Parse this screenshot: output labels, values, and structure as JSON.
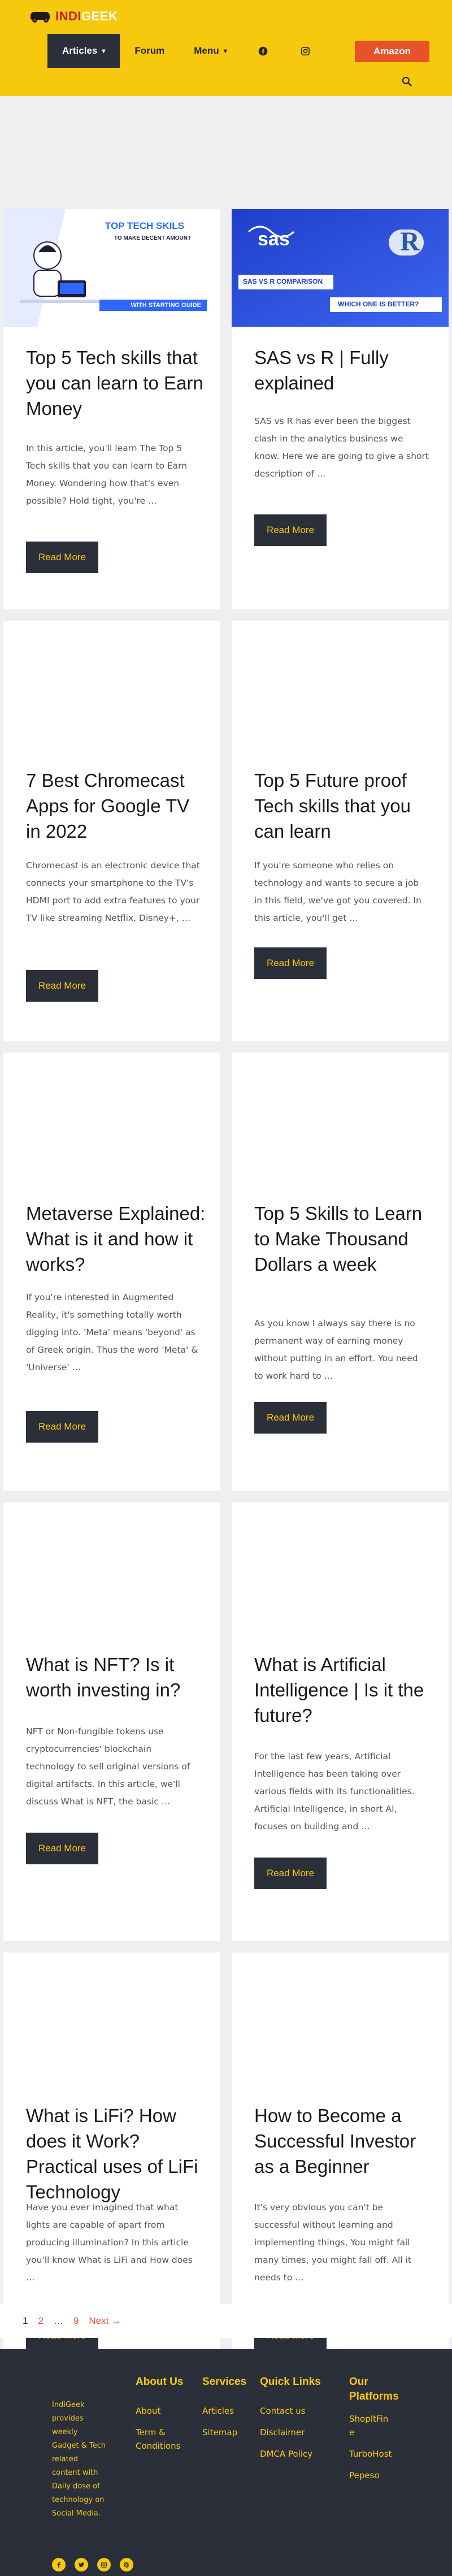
{
  "site": {
    "logo_part1": "INDI",
    "logo_part2": "GEEK",
    "logo_alt": "IndiGeek"
  },
  "nav": {
    "items": [
      {
        "label": "Articles",
        "has_dropdown": true,
        "active": true
      },
      {
        "label": "Forum",
        "has_dropdown": false
      },
      {
        "label": "Menu",
        "has_dropdown": true
      }
    ],
    "social": [
      "facebook-icon",
      "instagram-icon"
    ],
    "cta_label": "Amazon",
    "search_icon": "search-icon",
    "colors": {
      "header_bg": "#f6c90e",
      "active_bg": "#2b2f3a",
      "cta_bg": "#e8522b"
    }
  },
  "posts": [
    {
      "image": {
        "title": "TOP TECH SKILS",
        "subtitle": "TO MAKE DECENT AMOUNT",
        "badge": "WITH STARTING GUIDE"
      },
      "title": "Top 5 Tech skills that you can learn to Earn Money",
      "excerpt": "In this article, you'll learn The Top 5 Tech skills that you can learn to Earn Money. Wondering how that's even possible? Hold tight, you're …",
      "read_more": "Read More"
    },
    {
      "image": {
        "logo_left": "sas",
        "logo_right": "R",
        "tag1": "SAS VS R COMPARISON",
        "tag2": "WHICH ONE IS BETTER?"
      },
      "title": "SAS vs R | Fully explained",
      "excerpt": "SAS vs R has ever been the biggest clash in the analytics business we know. Here we are going to give a short description of …",
      "read_more": "Read More"
    },
    {
      "title": "7 Best Chromecast Apps for Google TV in 2022",
      "excerpt": "Chromecast is an electronic device that connects your smartphone to the TV's HDMI port to add extra features to your TV like streaming Netflix, Disney+, …",
      "read_more": "Read More"
    },
    {
      "title": "Top 5 Future proof Tech skills that you can learn",
      "excerpt": "If you're someone who relies on technology and wants to secure a job in this field, we've got you covered. In this article, you'll get …",
      "read_more": "Read More"
    },
    {
      "title": "Metaverse Explained: What is it and how it works?",
      "excerpt": "If you're interested in Augmented Reality, it's something totally worth digging into. 'Meta' means 'beyond' as of Greek origin. Thus the word 'Meta' & 'Universe' …",
      "read_more": "Read More"
    },
    {
      "title": "Top 5 Skills to Learn to Make Thousand Dollars a week",
      "excerpt": "As you know I always say there is no permanent way of earning money without putting in an effort. You need to work hard to …",
      "read_more": "Read More"
    },
    {
      "title": "What is NFT? Is it worth investing in?",
      "excerpt": "NFT or Non-fungible tokens use cryptocurrencies' blockchain technology to sell original versions of digital artifacts. In this article, we'll discuss What is NFT, the basic …",
      "read_more": "Read More"
    },
    {
      "title": "What is Artificial Intelligence | Is it the future?",
      "excerpt": "For the last few years, Artificial Intelligence has been taking over various fields with its functionalities. Artificial Intelligence, in short AI, focuses on building and …",
      "read_more": "Read More"
    },
    {
      "title": "What is LiFi? How does it Work? Practical uses of LiFi Technology",
      "excerpt": "Have you ever imagined that what lights are capable of apart from producing illumination? In this article you'll know What is LiFi and How does …",
      "read_more": "Read More"
    },
    {
      "title": "How to Become a Successful Investor as a Beginner",
      "excerpt": "It's very obvious you can't be successful without learning and implementing things, You might fail many times, you might fall off. All it needs to …",
      "read_more": "Read More"
    }
  ],
  "pagination": {
    "pages": [
      "1",
      "2",
      "…",
      "9"
    ],
    "current": "1",
    "next_label": "Next →"
  },
  "footer": {
    "about_text": "IndiGeek provides weekly Gadget & Tech related content with Daily dose of technology on Social Media.",
    "social": [
      "facebook-icon",
      "twitter-icon",
      "instagram-icon",
      "pinterest-icon"
    ],
    "columns": [
      {
        "heading": "About Us",
        "links": [
          "About",
          "Term & Conditions"
        ]
      },
      {
        "heading": "Services",
        "links": [
          "Articles",
          "Sitemap"
        ]
      },
      {
        "heading": "Quick Links",
        "links": [
          "Contact us",
          "Disclaimer",
          "DMCA Policy"
        ]
      },
      {
        "heading": "Our Platforms",
        "links": [
          "ShopItFine",
          "TurboHost",
          "Pepeso"
        ]
      }
    ]
  }
}
